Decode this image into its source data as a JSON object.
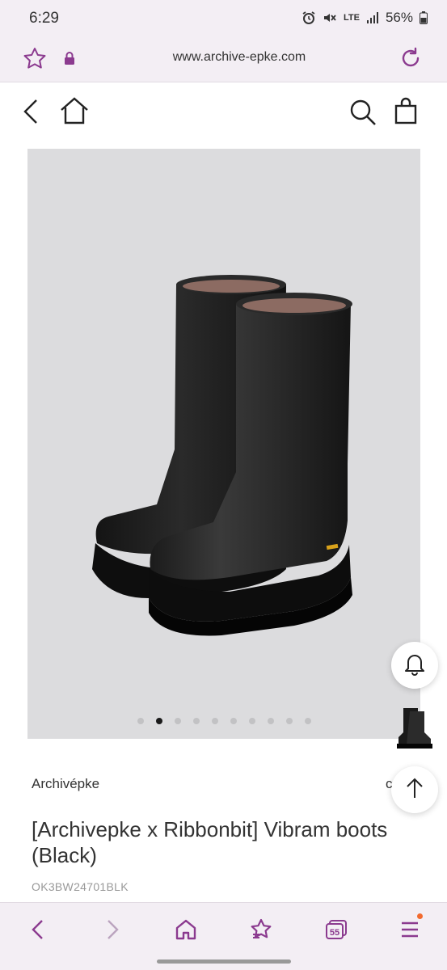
{
  "status": {
    "time": "6:29",
    "network": "LTE",
    "battery": "56%"
  },
  "browser": {
    "url": "www.archive-epke.com",
    "tab_count": "55"
  },
  "colors": {
    "accent": "#8b3a8f",
    "chrome_bg": "#f3eef4",
    "image_bg": "#dcdcde",
    "badge": "#f26a2e"
  },
  "carousel": {
    "total": 10,
    "active_index": 1
  },
  "product": {
    "brand": "Archivépke",
    "brand_extra": "c",
    "title": "[Archivepke x Ribbonbit] Vibram boots(Black)",
    "sku": "OK3BW24701BLK",
    "image_alt": "Black leather Vibram boots"
  },
  "icons": {
    "status": [
      "alarm-icon",
      "mute-icon",
      "lte-icon",
      "signal-icon",
      "battery-icon"
    ],
    "browser": [
      "star-icon",
      "lock-icon",
      "reload-icon"
    ],
    "header": [
      "back-icon",
      "home-icon",
      "search-icon",
      "bag-icon"
    ],
    "floating": [
      "bell-icon",
      "arrow-up-icon"
    ],
    "nav": [
      "chevron-left-icon",
      "chevron-right-icon",
      "home-icon",
      "bookmarks-icon",
      "tabs-icon",
      "menu-icon"
    ]
  }
}
